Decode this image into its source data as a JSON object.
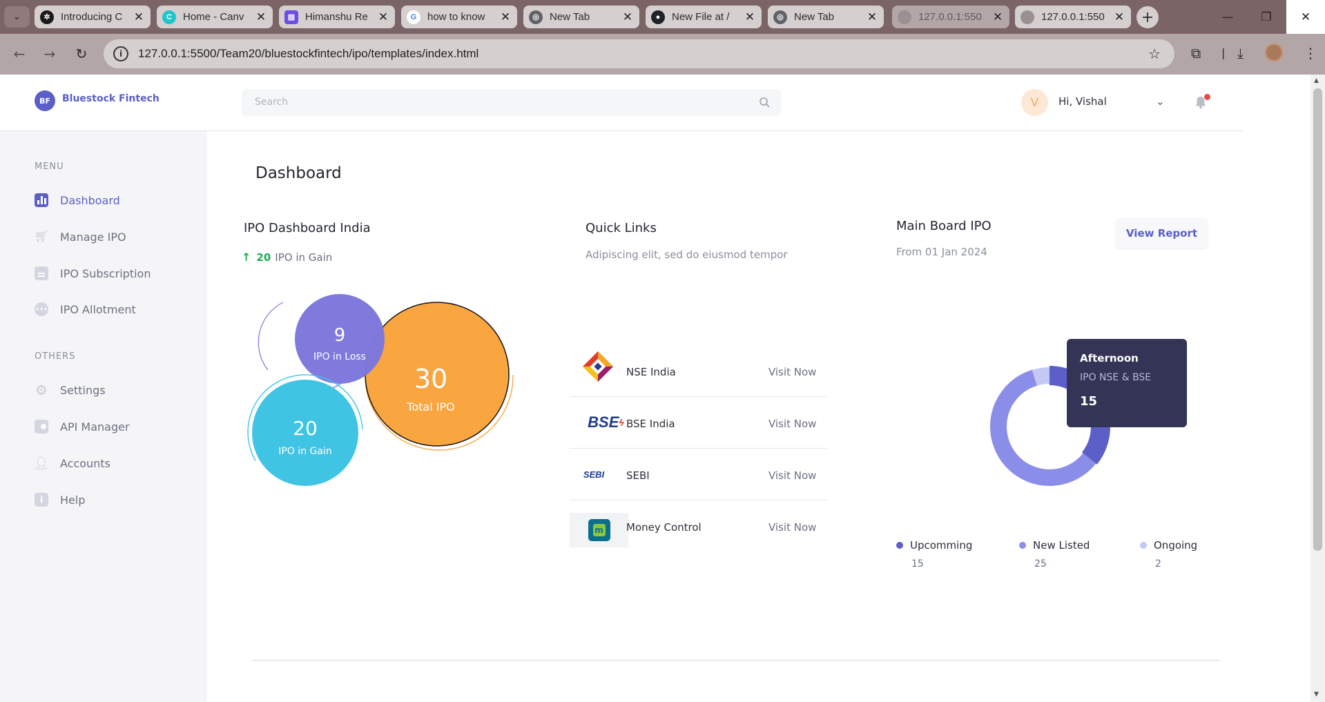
{
  "browser": {
    "tabs": [
      {
        "title": "Introducing C",
        "icon": "openai-icon",
        "color": "#1a1a1a"
      },
      {
        "title": "Home - Canv",
        "icon": "canva-icon",
        "color": "#20c4cb"
      },
      {
        "title": "Himanshu Re",
        "icon": "printer-icon",
        "color": "#6c4de6"
      },
      {
        "title": "how to know",
        "icon": "google-icon",
        "color": "#4285f4"
      },
      {
        "title": "New Tab",
        "icon": "chrome-icon",
        "color": "#5f6368"
      },
      {
        "title": "New File at /",
        "icon": "github-icon",
        "color": "#1f2328"
      },
      {
        "title": "New Tab",
        "icon": "chrome-icon",
        "color": "#5f6368"
      },
      {
        "title": "127.0.0.1:550",
        "icon": "globe-icon",
        "color": "#9a9090"
      },
      {
        "title": "127.0.0.1:550",
        "icon": "globe-icon",
        "color": "#9a9090"
      }
    ],
    "url": "127.0.0.1:5500/Team20/bluestockfintech/ipo/templates/index.html"
  },
  "brand": {
    "logo": "BF",
    "name": "Bluestock Fintech"
  },
  "search": {
    "placeholder": "Search"
  },
  "user": {
    "initial": "V",
    "greeting": "Hi, Vishal"
  },
  "sidebar": {
    "menu_heading": "MENU",
    "menu": [
      {
        "label": "Dashboard",
        "icon": "chart-icon"
      },
      {
        "label": "Manage IPO",
        "icon": "cart-icon"
      },
      {
        "label": "IPO Subscription",
        "icon": "document-icon"
      },
      {
        "label": "IPO Allotment",
        "icon": "chat-icon"
      }
    ],
    "others_heading": "OTHERS",
    "others": [
      {
        "label": "Settings",
        "icon": "gear-icon"
      },
      {
        "label": "API Manager",
        "icon": "api-icon"
      },
      {
        "label": "Accounts",
        "icon": "user-icon"
      },
      {
        "label": "Help",
        "icon": "info-icon"
      }
    ]
  },
  "page_title": "Dashboard",
  "ipo_dashboard": {
    "title": "IPO Dashboard India",
    "gain_count": "20",
    "gain_text": "IPO in Gain",
    "bubbles": [
      {
        "value": "30",
        "label": "Total IPO",
        "color": "#f9a640"
      },
      {
        "value": "9",
        "label": "IPO in Loss",
        "color": "#7d77dc"
      },
      {
        "value": "20",
        "label": "IPO in Gain",
        "color": "#40c4e4"
      }
    ]
  },
  "quick_links": {
    "title": "Quick Links",
    "subtitle": "Adipiscing elit, sed do eiusmod tempor",
    "items": [
      {
        "name": "NSE India",
        "action": "Visit Now",
        "logo": "nse-logo"
      },
      {
        "name": "BSE India",
        "action": "Visit Now",
        "logo": "bse-logo",
        "logo_text": "BSE"
      },
      {
        "name": "SEBI",
        "action": "Visit Now",
        "logo": "sebi-logo",
        "logo_text": "SEBI"
      },
      {
        "name": "Money Control",
        "action": "Visit Now",
        "logo": "moneycontrol-logo",
        "logo_text": "m"
      }
    ]
  },
  "main_board": {
    "title": "Main Board IPO",
    "subtitle": "From 01 Jan 2024",
    "view_report": "View Report",
    "tooltip": {
      "title": "Afternoon",
      "subtitle": "IPO NSE & BSE",
      "value": "15"
    },
    "legend": [
      {
        "label": "Upcomming",
        "value": "15",
        "color": "#5b5fc7"
      },
      {
        "label": "New Listed",
        "value": "25",
        "color": "#8a8ee8"
      },
      {
        "label": "Ongoing",
        "value": "2",
        "color": "#c5c7f7"
      }
    ]
  },
  "chart_data": {
    "type": "pie",
    "title": "Main Board IPO",
    "series": [
      {
        "name": "Upcomming",
        "value": 15,
        "color": "#5b5fc7"
      },
      {
        "name": "New Listed",
        "value": 25,
        "color": "#8a8ee8"
      },
      {
        "name": "Ongoing",
        "value": 2,
        "color": "#c5c7f7"
      }
    ]
  }
}
